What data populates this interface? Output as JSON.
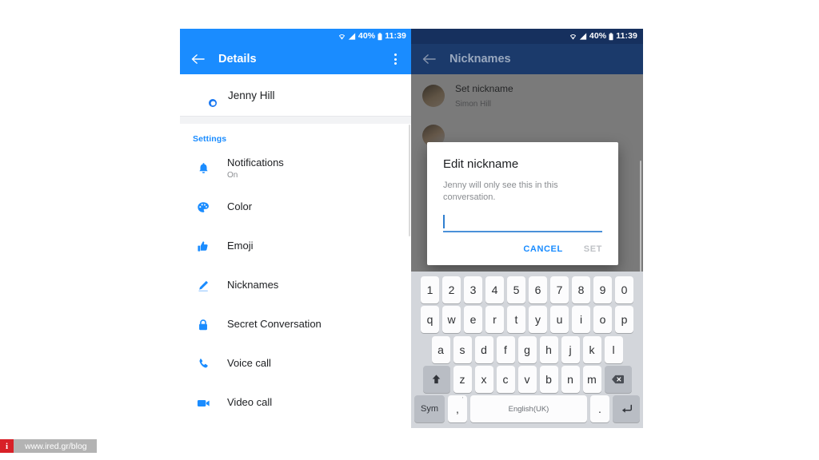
{
  "status_bar": {
    "battery_percent": "40%",
    "time": "11:39",
    "wifi_icon": "wifi-icon",
    "signal_icon": "signal-bars-icon",
    "battery_icon": "battery-icon"
  },
  "left_phone": {
    "appbar": {
      "back_icon": "back-arrow-icon",
      "title": "Details",
      "overflow_icon": "overflow-menu-icon"
    },
    "contact": {
      "name": "Jenny Hill",
      "avatar_icon": "avatar",
      "badge_icon": "messenger-badge-icon"
    },
    "section_label": "Settings",
    "items": [
      {
        "icon": "bell-icon",
        "title": "Notifications",
        "subtitle": "On"
      },
      {
        "icon": "palette-icon",
        "title": "Color",
        "subtitle": ""
      },
      {
        "icon": "thumbs-up-icon",
        "title": "Emoji",
        "subtitle": ""
      },
      {
        "icon": "pencil-icon",
        "title": "Nicknames",
        "subtitle": ""
      },
      {
        "icon": "lock-icon",
        "title": "Secret Conversation",
        "subtitle": ""
      },
      {
        "icon": "phone-icon",
        "title": "Voice call",
        "subtitle": ""
      },
      {
        "icon": "video-camera-icon",
        "title": "Video call",
        "subtitle": ""
      }
    ]
  },
  "right_phone": {
    "appbar": {
      "back_icon": "back-arrow-icon",
      "title": "Nicknames"
    },
    "list": [
      {
        "title": "Set nickname",
        "subtitle": "Simon Hill"
      },
      {
        "title": "",
        "subtitle": ""
      }
    ],
    "dialog": {
      "title": "Edit nickname",
      "message": "Jenny will only see this in this conversation.",
      "input_value": "",
      "cancel_label": "CANCEL",
      "set_label": "SET"
    },
    "keyboard": {
      "row1": [
        "1",
        "2",
        "3",
        "4",
        "5",
        "6",
        "7",
        "8",
        "9",
        "0"
      ],
      "row2": [
        "q",
        "w",
        "e",
        "r",
        "t",
        "y",
        "u",
        "i",
        "o",
        "p"
      ],
      "row3": [
        "a",
        "s",
        "d",
        "f",
        "g",
        "h",
        "j",
        "k",
        "l"
      ],
      "row4": [
        "z",
        "x",
        "c",
        "v",
        "b",
        "n",
        "m"
      ],
      "shift_icon": "shift-arrow-icon",
      "backspace_icon": "backspace-icon",
      "sym_label": "Sym",
      "comma_label": ",",
      "comma_sup": "'",
      "space_label": "English(UK)",
      "period_label": ".",
      "enter_icon": "enter-return-icon"
    }
  },
  "watermark": {
    "mark": "i",
    "url": "www.ired.gr/blog"
  },
  "colors": {
    "messenger_blue": "#1a8cff",
    "dark_navy": "#1b3a6b",
    "disabled_grey": "#bfc2c6",
    "watermark_red": "#d82128"
  }
}
